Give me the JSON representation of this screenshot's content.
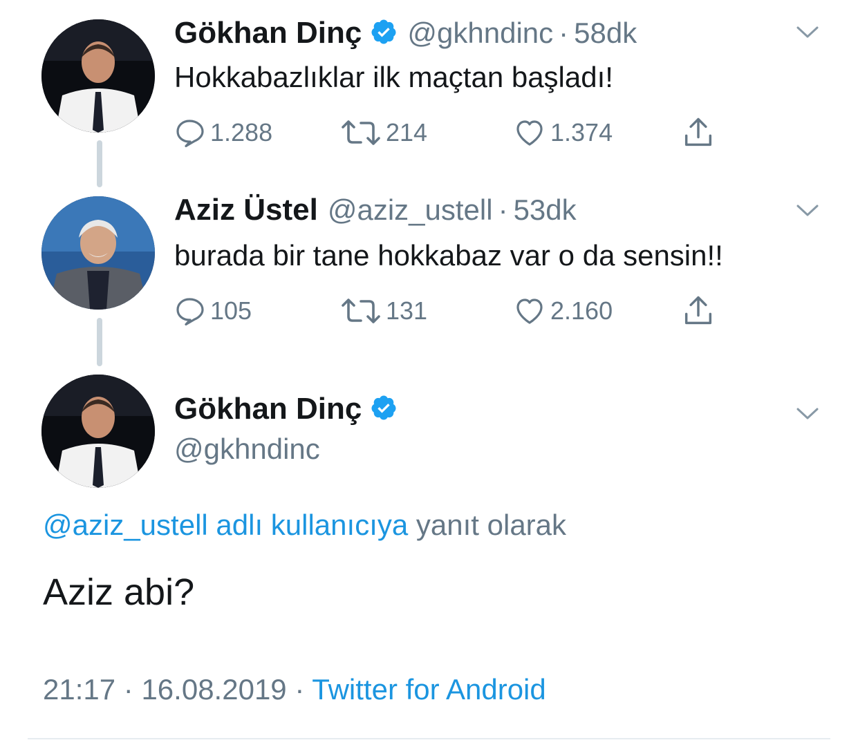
{
  "tweets": [
    {
      "name": "Gökhan Dinç",
      "verified": true,
      "handle": "@gkhndinc",
      "separator": "·",
      "time": "58dk",
      "text": "Hokkabazlıklar ilk maçtan başladı!",
      "replies": "1.288",
      "retweets": "214",
      "likes": "1.374"
    },
    {
      "name": "Aziz Üstel",
      "verified": false,
      "handle": "@aziz_ustell",
      "separator": "·",
      "time": "53dk",
      "text": "burada bir tane hokkabaz var o da sensin!!",
      "replies": "105",
      "retweets": "131",
      "likes": "2.160"
    }
  ],
  "main_tweet": {
    "name": "Gökhan Dinç",
    "verified": true,
    "handle": "@gkhndinc",
    "reply_to_link": "@aziz_ustell adlı kullanıcıya",
    "reply_to_suffix": "yanıt olarak",
    "text": "Aziz abi?",
    "time": "21:17",
    "sep1": "·",
    "date": "16.08.2019",
    "sep2": "·",
    "source": "Twitter for Android"
  },
  "colors": {
    "accent": "#1b95e0",
    "muted": "#657786",
    "thread_line": "#ccd6dd",
    "verified": "#1da1f2"
  },
  "icons": [
    "reply-icon",
    "retweet-icon",
    "like-icon",
    "share-icon",
    "chevron-down-icon",
    "verified-badge-icon"
  ]
}
